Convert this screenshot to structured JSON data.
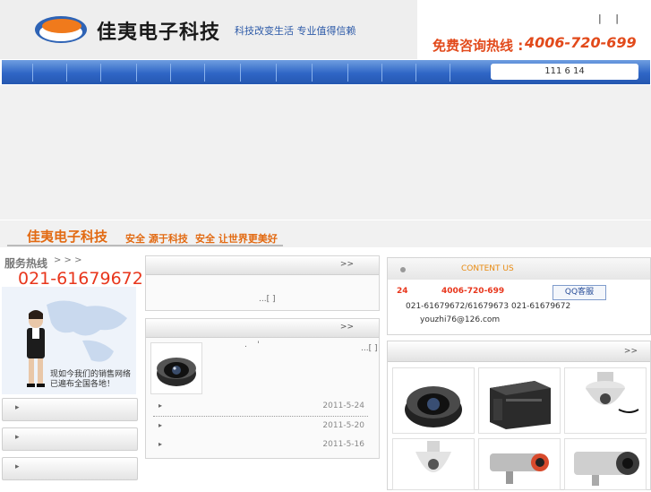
{
  "header": {
    "brand": "佳夷电子科技",
    "slogan": "科技改变生活 专业值得信赖",
    "top_links": "| |",
    "hotline_label": "免费咨询热线 :",
    "hotline_number": "4006-720-699"
  },
  "nav": {
    "date_text": "111 6 14"
  },
  "tagline": {
    "brand": "佳夷电子科技",
    "phrase1": "安全 源于科技",
    "phrase2": "安全 让世界更美好"
  },
  "service": {
    "label": "服务热线",
    "arrows": "> > >",
    "phone": "021-61679672",
    "note_line1": "现如今我们的销售网络",
    "note_line2": "已遍布全国各地！"
  },
  "panels": {
    "top_more": ">>",
    "top_news": "...[ ]",
    "mid_more": ">>",
    "mid_marks": ".    '",
    "mid_bracket": "...[ ]",
    "rows": [
      {
        "date": "2011-5-24"
      },
      {
        "date": "2011-5-20"
      },
      {
        "date": "2011-5-16"
      }
    ]
  },
  "contact": {
    "title": "CONTENT US",
    "label_24": "24",
    "hotline": "4006-720-699",
    "qq_label": "QQ客服",
    "phones": "021-61679672/61679673",
    "phone2": "021-61679672",
    "email": "youzhi76@126.com"
  },
  "products": {
    "more": ">>"
  },
  "colors": {
    "accent_orange": "#e24a1b",
    "nav_blue": "#2f66c6",
    "phone_red": "#e8361c"
  }
}
